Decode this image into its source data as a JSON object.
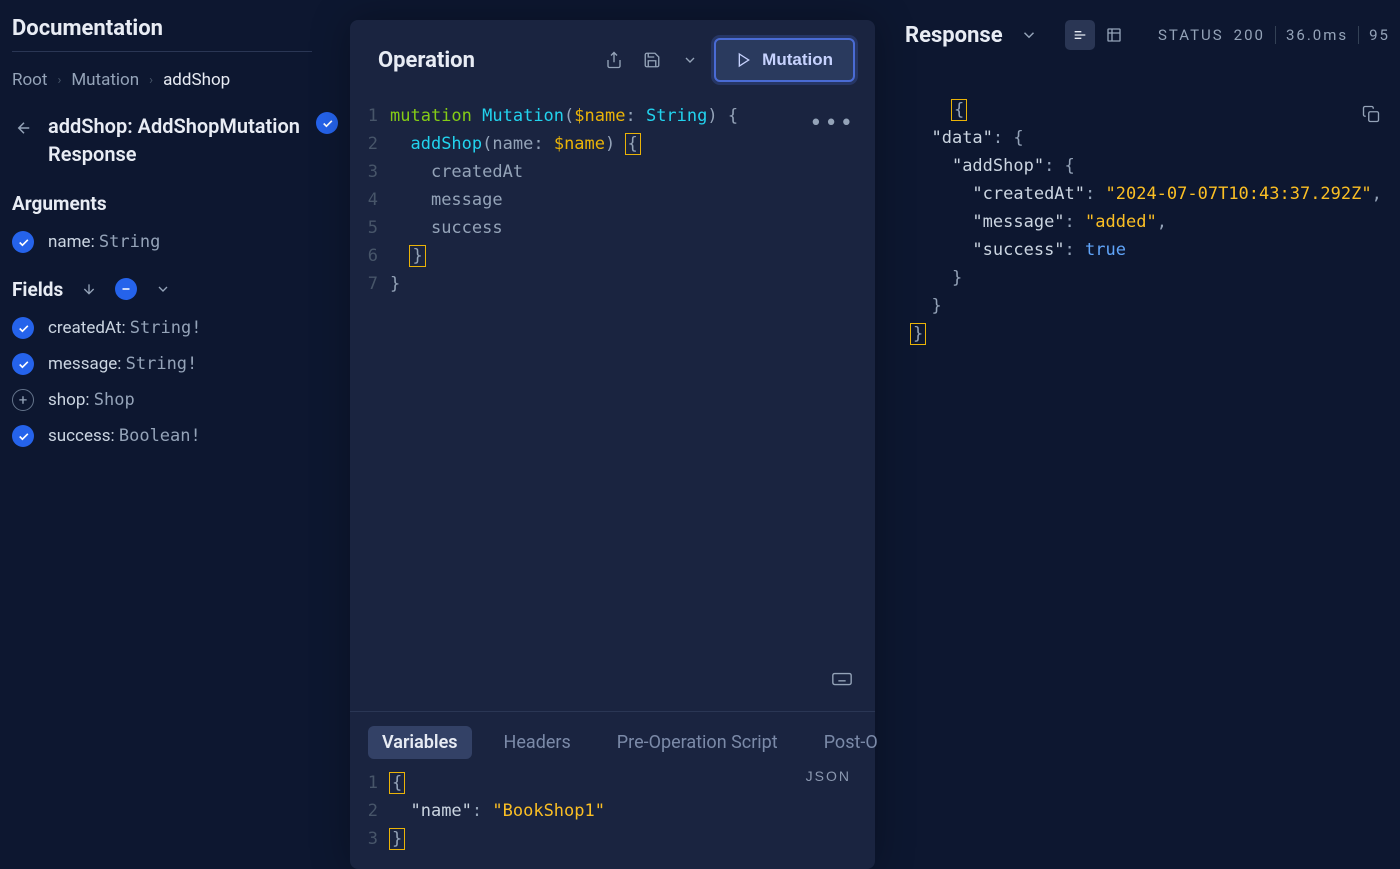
{
  "sidebar": {
    "title": "Documentation",
    "breadcrumb": {
      "root": "Root",
      "mid": "Mutation",
      "current": "addShop"
    },
    "typeSignature": "addShop: AddShopMutationResponse",
    "argsHeading": "Arguments",
    "arguments": [
      {
        "name": "name",
        "type": "String",
        "selected": true
      }
    ],
    "fieldsHeading": "Fields",
    "fields": [
      {
        "name": "createdAt",
        "type": "String!",
        "selected": true
      },
      {
        "name": "message",
        "type": "String!",
        "selected": true
      },
      {
        "name": "shop",
        "type": "Shop",
        "selected": false
      },
      {
        "name": "success",
        "type": "Boolean!",
        "selected": true
      }
    ]
  },
  "operation": {
    "title": "Operation",
    "runLabel": "Mutation",
    "code": {
      "kw": "mutation",
      "opName": "Mutation",
      "varName": "$name",
      "varType": "String",
      "fnName": "addShop",
      "argKey": "name",
      "argVar": "$name",
      "f1": "createdAt",
      "f2": "message",
      "f3": "success"
    }
  },
  "bottom": {
    "tabs": {
      "t0": "Variables",
      "t1": "Headers",
      "t2": "Pre-Operation Script",
      "t3": "Post-O"
    },
    "jsonBadge": "JSON",
    "vars": {
      "key": "\"name\"",
      "value": "\"BookShop1\""
    }
  },
  "response": {
    "title": "Response",
    "statusLabel": "STATUS",
    "statusCode": "200",
    "time": "36.0ms",
    "size": "95",
    "body": {
      "dataKey": "\"data\"",
      "addShopKey": "\"addShop\"",
      "createdAtKey": "\"createdAt\"",
      "createdAtVal": "\"2024-07-07T10:43:37.292Z\"",
      "messageKey": "\"message\"",
      "messageVal": "\"added\"",
      "successKey": "\"success\"",
      "successVal": "true"
    }
  }
}
